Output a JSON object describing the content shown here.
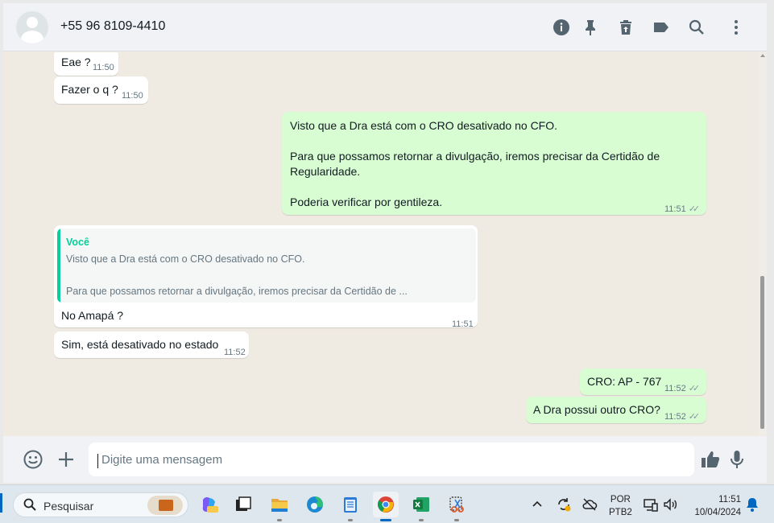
{
  "header": {
    "contact": "+55 96 8109-4410",
    "icons": [
      "info-icon",
      "pin-icon",
      "delete-icon",
      "label-icon",
      "search-icon",
      "menu-dots-icon"
    ]
  },
  "messages": [
    {
      "dir": "in",
      "text": "Eae ?",
      "time": "11:50"
    },
    {
      "dir": "in",
      "text": "Fazer o q ?",
      "time": "11:50"
    },
    {
      "dir": "out",
      "text": "Visto que a Dra está com o CRO desativado no CFO.\n\nPara que possamos retornar a divulgação, iremos precisar da Certidão de\nRegularidade.\n\nPoderia verificar por gentileza.",
      "time": "11:51"
    },
    {
      "dir": "in",
      "quote_author": "Você",
      "quote_text": "Visto que a Dra está com o CRO desativado no CFO.\n\nPara que possamos retornar a divulgação, iremos precisar da Certidão de ...",
      "text": "No Amapá ?",
      "time": "11:51"
    },
    {
      "dir": "in",
      "text": "Sim, está desativado no estado",
      "time": "11:52"
    },
    {
      "dir": "out",
      "text": "CRO: AP - 767",
      "time": "11:52"
    },
    {
      "dir": "out",
      "text": "A Dra possui outro CRO?",
      "time": "11:52"
    }
  ],
  "footer": {
    "placeholder": "Digite uma mensagem",
    "icons": [
      "emoji-icon",
      "attach-plus-icon",
      "thumbs-up-icon",
      "microphone-icon"
    ]
  },
  "taskbar": {
    "search_label": "Pesquisar",
    "lang_top": "POR",
    "lang_bottom": "PTB2",
    "time": "11:51",
    "date": "10/04/2024"
  },
  "colors": {
    "chat_bg": "#efeae2",
    "incoming": "#ffffff",
    "outgoing": "#d9fdd3",
    "quote_accent": "#06cf9c",
    "header_bg": "#f0f2f5"
  }
}
